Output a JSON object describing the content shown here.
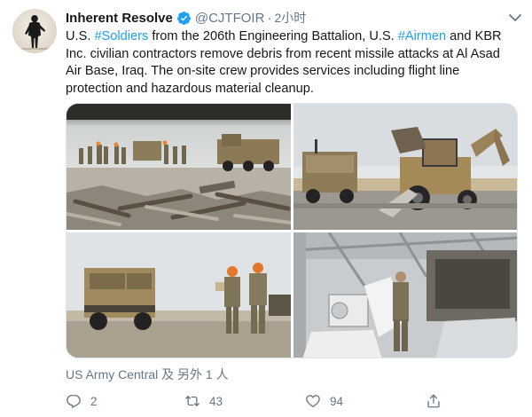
{
  "tweet": {
    "author_name": "Inherent Resolve",
    "author_handle": "@CJTFOIR",
    "time_separator": "·",
    "time": "2小时",
    "verified_icon": "verified-badge-icon",
    "text": {
      "part1": "U.S. ",
      "hashtag1": "#Soldiers",
      "part2": " from the 206th Engineering Battalion, U.S. ",
      "hashtag2": "#Airmen",
      "part3": " and KBR Inc. civilian contractors remove debris from recent missile attacks at Al Asad Air Base, Iraq. The on-site crew provides services including flight line protection and hazardous material cleanup."
    },
    "tagged_users": "US Army Central 及 另外 1 人",
    "actions": {
      "reply_count": "2",
      "retweet_count": "43",
      "like_count": "94"
    }
  },
  "colors": {
    "link": "#1da1f2",
    "muted": "#657786",
    "text": "#14171a",
    "border": "#e1e8ed"
  },
  "icons": [
    "avatar-soldier-silhouette",
    "verified-badge-icon",
    "chevron-down-icon",
    "reply-icon",
    "retweet-icon",
    "like-icon",
    "share-icon"
  ]
}
